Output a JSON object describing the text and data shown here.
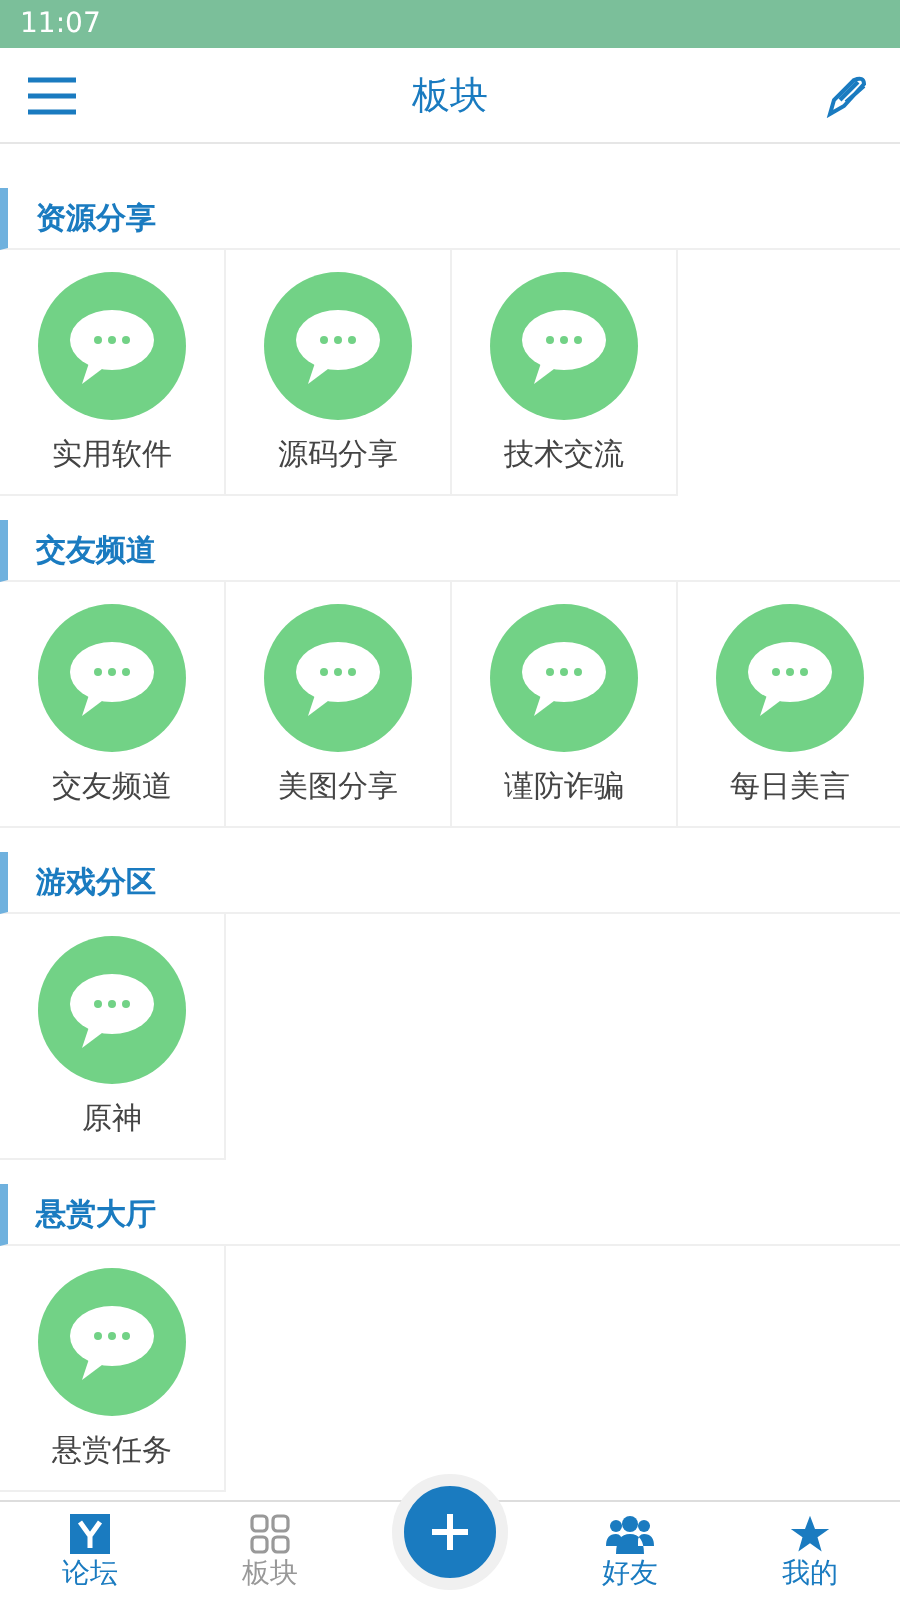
{
  "status_bar": {
    "time": "11:07"
  },
  "header": {
    "title": "板块"
  },
  "sections": [
    {
      "title": "资源分享",
      "boards": [
        {
          "name": "实用软件"
        },
        {
          "name": "源码分享"
        },
        {
          "name": "技术交流"
        }
      ]
    },
    {
      "title": "交友频道",
      "boards": [
        {
          "name": "交友频道"
        },
        {
          "name": "美图分享"
        },
        {
          "name": "谨防诈骗"
        },
        {
          "name": "每日美言"
        }
      ]
    },
    {
      "title": "游戏分区",
      "boards": [
        {
          "name": "原神"
        }
      ]
    },
    {
      "title": "悬赏大厅",
      "boards": [
        {
          "name": "悬赏任务"
        }
      ]
    }
  ],
  "tabs": [
    {
      "kind": "forum",
      "label": "论坛",
      "selected": false
    },
    {
      "kind": "boards",
      "label": "板块",
      "selected": true
    },
    {
      "kind": "add"
    },
    {
      "kind": "friends",
      "label": "好友",
      "selected": false
    },
    {
      "kind": "mine",
      "label": "我的",
      "selected": false
    }
  ]
}
